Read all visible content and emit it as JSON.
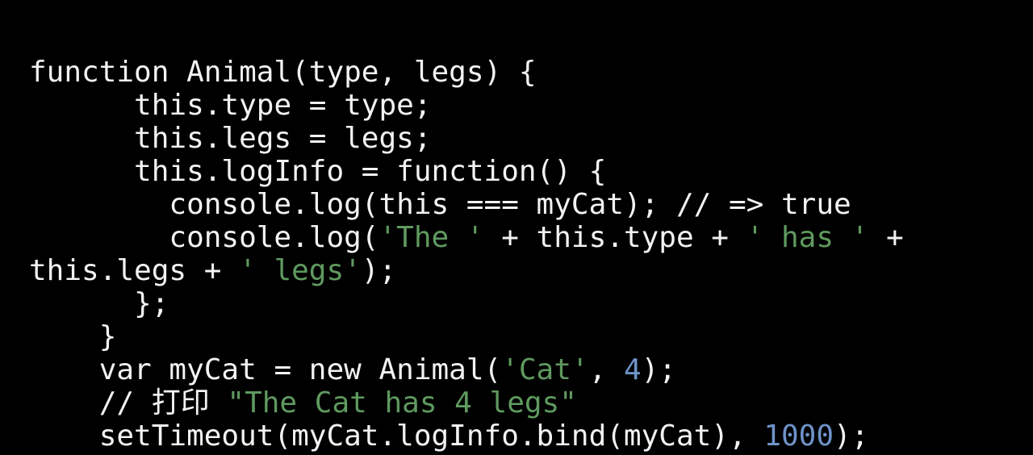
{
  "editor": {
    "language": "javascript",
    "background_color": "#000000",
    "foreground_color": "#f2f2f2",
    "string_color": "#5f9a5f",
    "number_color": "#6e93c9",
    "font_size_px": 36,
    "line_height_px": 41,
    "total_visual_lines": 12
  },
  "code": {
    "lines": [
      {
        "indent": "",
        "tokens": [
          {
            "kind": "plain",
            "text": "function Animal(type, legs) {"
          }
        ]
      },
      {
        "indent": "      ",
        "tokens": [
          {
            "kind": "plain",
            "text": "this.type = type;"
          }
        ]
      },
      {
        "indent": "      ",
        "tokens": [
          {
            "kind": "plain",
            "text": "this.legs = legs;"
          }
        ]
      },
      {
        "indent": "      ",
        "tokens": [
          {
            "kind": "plain",
            "text": "this.logInfo = function() {"
          }
        ]
      },
      {
        "indent": "        ",
        "tokens": [
          {
            "kind": "plain",
            "text": "console.log(this === myCat); "
          },
          {
            "kind": "comment",
            "text": "// => true"
          }
        ]
      },
      {
        "indent": "        ",
        "tokens": [
          {
            "kind": "plain",
            "text": "console.log("
          },
          {
            "kind": "string",
            "text": "'The '"
          },
          {
            "kind": "plain",
            "text": " + this.type + "
          },
          {
            "kind": "string",
            "text": "' has '"
          },
          {
            "kind": "plain",
            "text": " +"
          }
        ]
      },
      {
        "indent": "",
        "tokens": [
          {
            "kind": "plain",
            "text": "this.legs + "
          },
          {
            "kind": "string",
            "text": "' legs'"
          },
          {
            "kind": "plain",
            "text": ");"
          }
        ]
      },
      {
        "indent": "      ",
        "tokens": [
          {
            "kind": "plain",
            "text": "};"
          }
        ]
      },
      {
        "indent": "    ",
        "tokens": [
          {
            "kind": "plain",
            "text": "}"
          }
        ]
      },
      {
        "indent": "    ",
        "tokens": [
          {
            "kind": "plain",
            "text": "var myCat = new Animal("
          },
          {
            "kind": "string",
            "text": "'Cat'"
          },
          {
            "kind": "plain",
            "text": ", "
          },
          {
            "kind": "number",
            "text": "4"
          },
          {
            "kind": "plain",
            "text": ");"
          }
        ]
      },
      {
        "indent": "    ",
        "tokens": [
          {
            "kind": "comment",
            "text": "// 打印 "
          },
          {
            "kind": "string",
            "text": "\"The Cat has 4 legs\""
          }
        ]
      },
      {
        "indent": "    ",
        "tokens": [
          {
            "kind": "plain",
            "text": "setTimeout(myCat.logInfo.bind(myCat), "
          },
          {
            "kind": "number",
            "text": "1000"
          },
          {
            "kind": "plain",
            "text": ");"
          }
        ]
      }
    ]
  }
}
